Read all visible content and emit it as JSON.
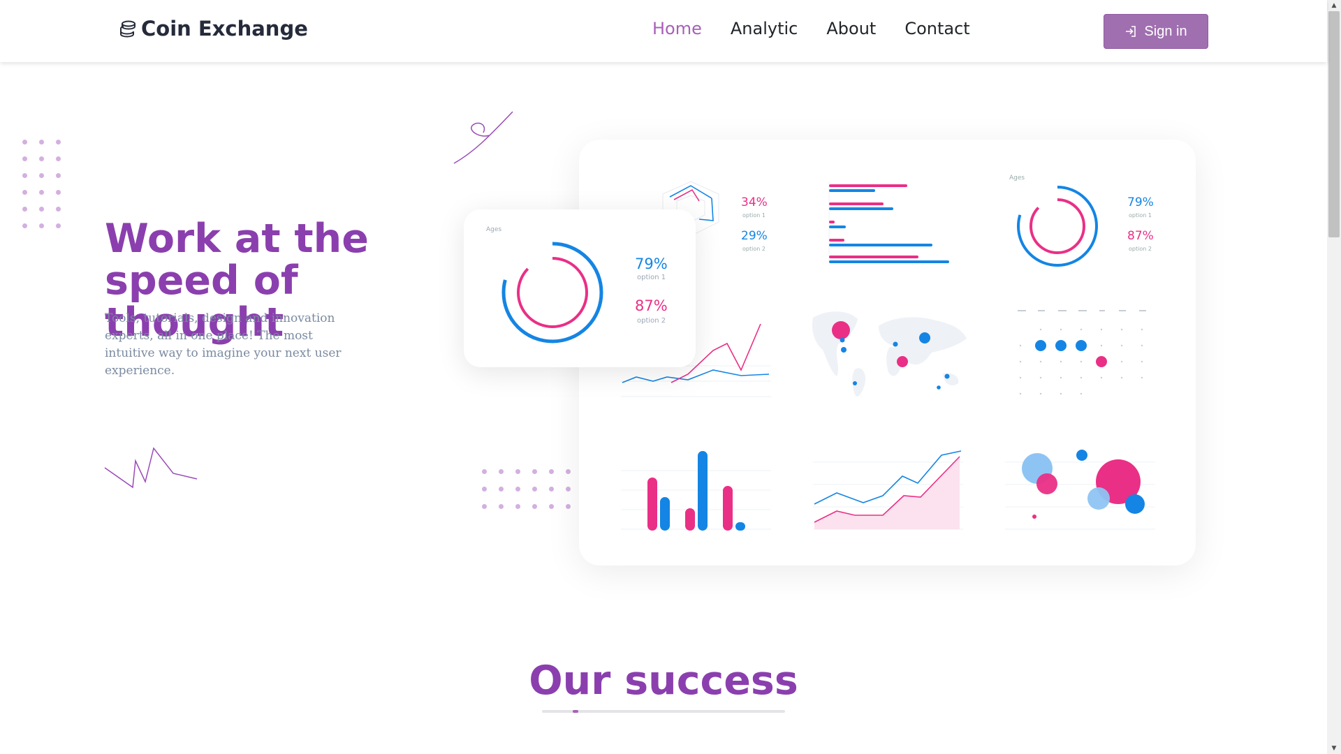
{
  "header": {
    "brand": "Coin Exchange",
    "brand_icon": "coins-icon",
    "nav": [
      {
        "label": "Home",
        "active": true
      },
      {
        "label": "Analytic",
        "active": false
      },
      {
        "label": "About",
        "active": false
      },
      {
        "label": "Contact",
        "active": false
      }
    ],
    "signin_label": "Sign in",
    "signin_icon": "sign-in-icon"
  },
  "hero": {
    "title_line1": "Work at the",
    "title_line2": "speed of thought",
    "description": "Tools, tutorials, design and innovation experts, all in one place! The most intuitive way to imagine your next user experience."
  },
  "dashboard": {
    "radar": {
      "pct1": "34%",
      "opt1": "option 1",
      "pct2": "29%",
      "opt2": "option 2"
    },
    "donut": {
      "ages": "Ages",
      "pct1": "79%",
      "opt1": "option 1",
      "pct2": "87%",
      "opt2": "option 2"
    }
  },
  "float_card": {
    "ages": "Ages",
    "pct1": "79%",
    "opt1": "option 1",
    "pct2": "87%",
    "opt2": "option 2"
  },
  "success": {
    "title": "Our success"
  },
  "colors": {
    "accent": "#8b3fae",
    "button": "#a06fb0",
    "blue": "#1485e4",
    "pink": "#ea2f86"
  }
}
